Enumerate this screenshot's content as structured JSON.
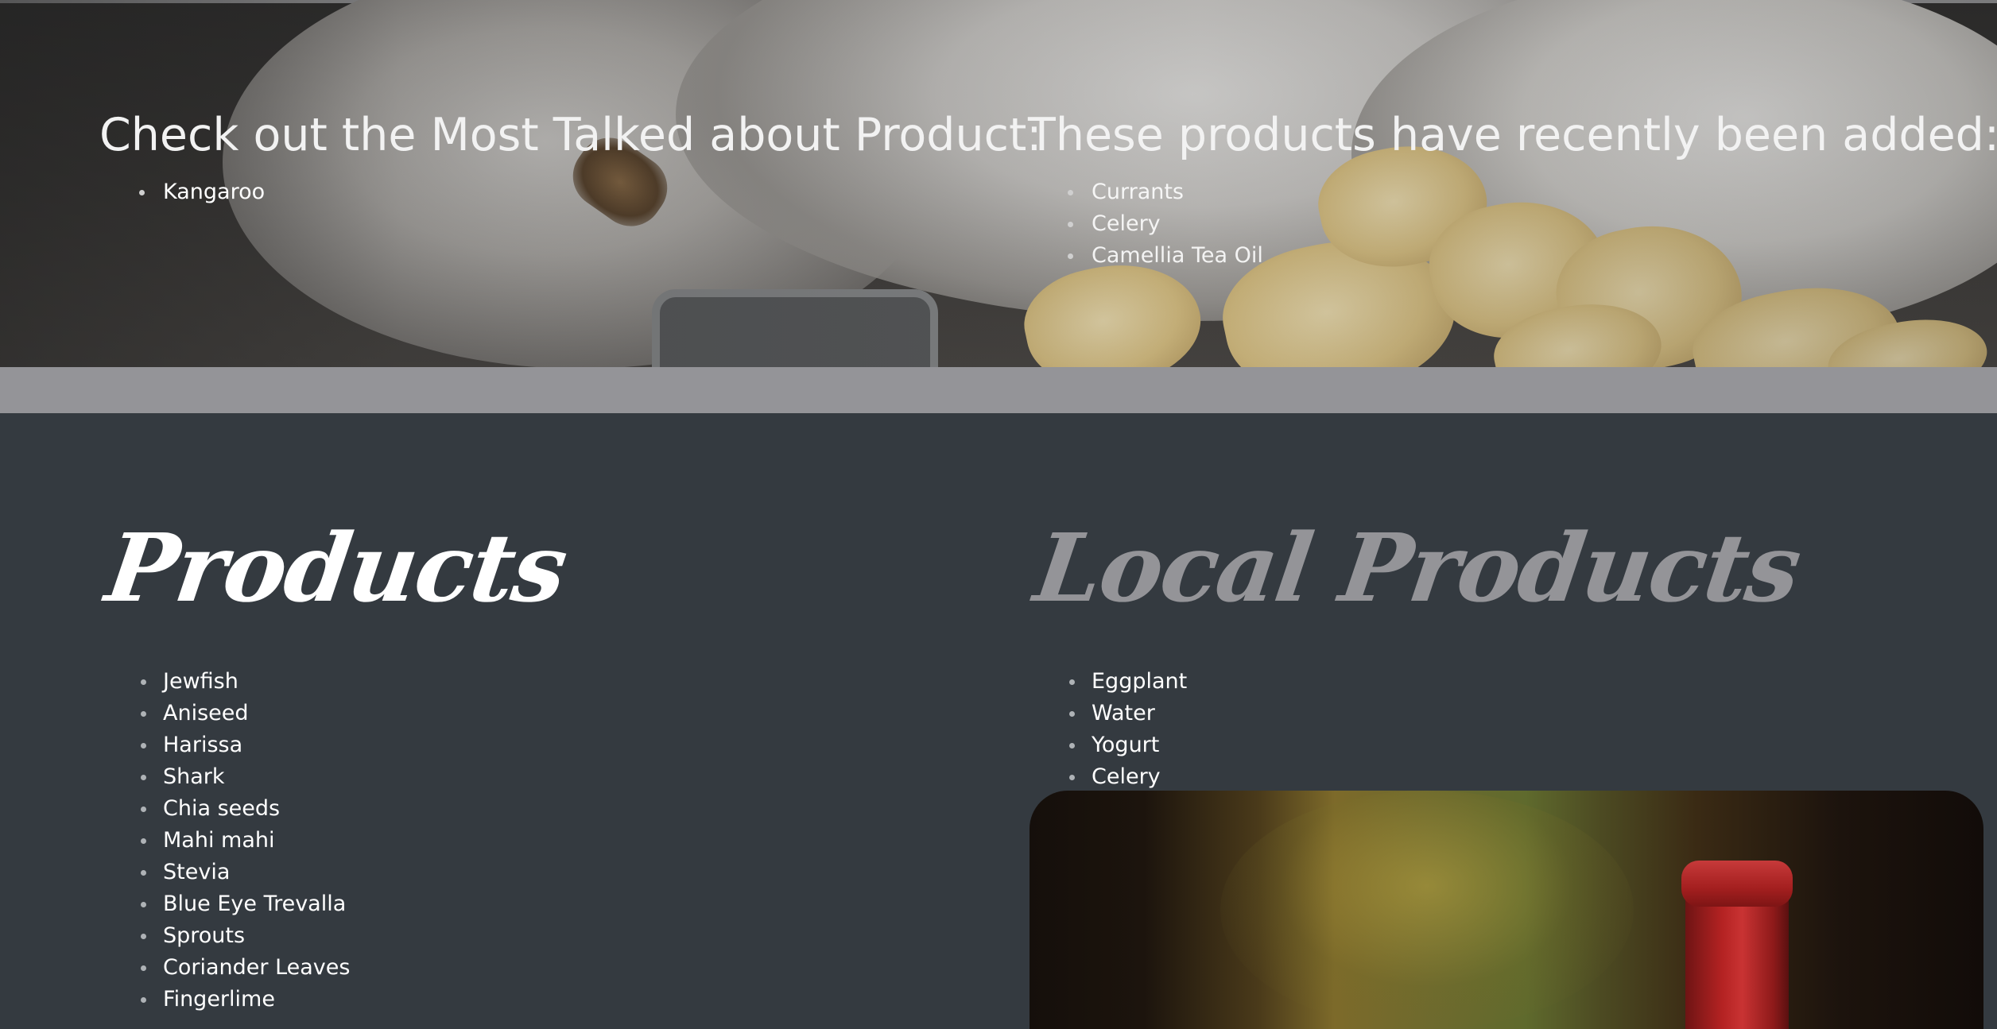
{
  "hero": {
    "left": {
      "title": "Check out the Most Talked about Product:",
      "items": [
        "Kangaroo"
      ]
    },
    "right": {
      "title": "These products have recently been added:",
      "items": [
        "Currants",
        "Celery",
        "Camellia Tea Oil"
      ]
    }
  },
  "products": {
    "title": "Products",
    "items": [
      "Jewfish",
      "Aniseed",
      "Harissa",
      "Shark",
      "Chia seeds",
      "Mahi mahi",
      "Stevia",
      "Blue Eye Trevalla",
      "Sprouts",
      "Coriander Leaves",
      "Fingerlime"
    ]
  },
  "local_products": {
    "title": "Local Products",
    "items": [
      "Eggplant",
      "Water",
      "Yogurt",
      "Celery"
    ]
  },
  "colors": {
    "background": "#343a40",
    "band": "#949498",
    "local_title": "#949498",
    "text": "#ffffff"
  }
}
